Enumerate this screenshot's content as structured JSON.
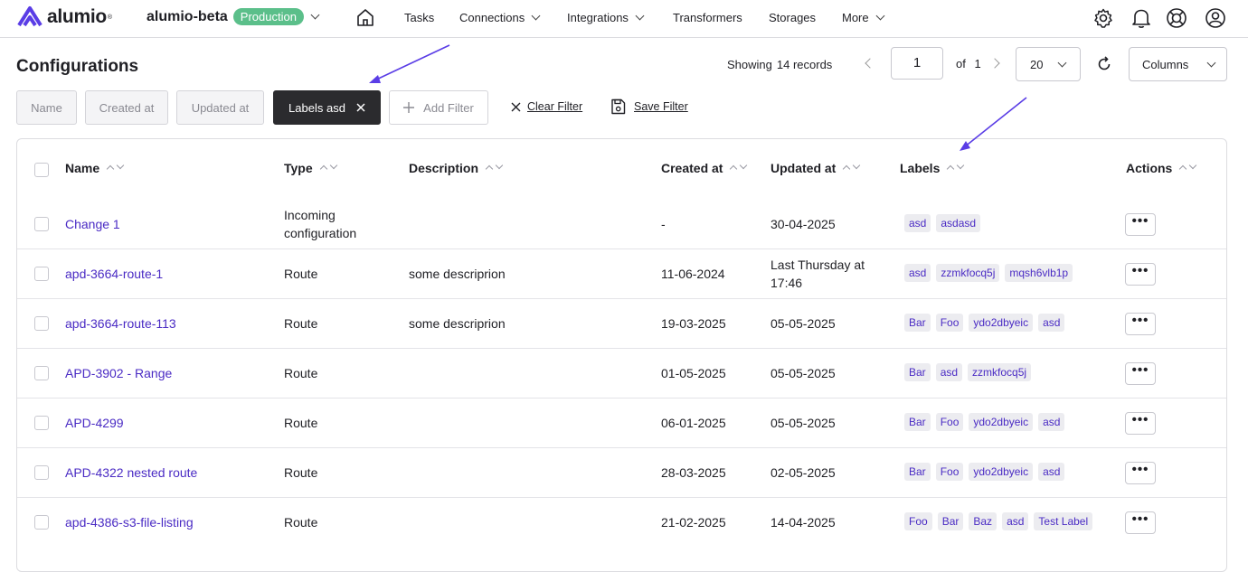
{
  "brand": {
    "name": "alumio",
    "reg": "®"
  },
  "environment": {
    "name": "alumio-beta",
    "badge": "Production"
  },
  "nav": {
    "items": [
      "Tasks",
      "Connections",
      "Integrations",
      "Transformers",
      "Storages",
      "More"
    ]
  },
  "page": {
    "title": "Configurations"
  },
  "pagination": {
    "showing_label": "Showing",
    "records": "14 records",
    "page": "1",
    "of_label": "of",
    "total_pages": "1",
    "page_size": "20",
    "columns_label": "Columns"
  },
  "filters": {
    "chips": [
      "Name",
      "Created at",
      "Updated at"
    ],
    "active": "Labels asd",
    "add": "Add Filter",
    "clear": "Clear Filter",
    "save": "Save Filter"
  },
  "table": {
    "headers": [
      "Name",
      "Type",
      "Description",
      "Created at",
      "Updated at",
      "Labels",
      "Actions"
    ],
    "rows": [
      {
        "name": "Change 1",
        "type": "Incoming configuration",
        "description": "",
        "created": "-",
        "updated": "30-04-2025",
        "labels": [
          "asd",
          "asdasd"
        ]
      },
      {
        "name": "apd-3664-route-1",
        "type": "Route",
        "description": "some descriprion",
        "created": "11-06-2024",
        "updated": "Last Thursday at 17:46",
        "labels": [
          "asd",
          "zzmkfocq5j",
          "mqsh6vlb1p"
        ]
      },
      {
        "name": "apd-3664-route-113",
        "type": "Route",
        "description": "some descriprion",
        "created": "19-03-2025",
        "updated": "05-05-2025",
        "labels": [
          "Bar",
          "Foo",
          "ydo2dbyeic",
          "asd"
        ]
      },
      {
        "name": "APD-3902 - Range",
        "type": "Route",
        "description": "",
        "created": "01-05-2025",
        "updated": "05-05-2025",
        "labels": [
          "Bar",
          "asd",
          "zzmkfocq5j"
        ]
      },
      {
        "name": "APD-4299",
        "type": "Route",
        "description": "",
        "created": "06-01-2025",
        "updated": "05-05-2025",
        "labels": [
          "Bar",
          "Foo",
          "ydo2dbyeic",
          "asd"
        ]
      },
      {
        "name": "APD-4322 nested route",
        "type": "Route",
        "description": "",
        "created": "28-03-2025",
        "updated": "02-05-2025",
        "labels": [
          "Bar",
          "Foo",
          "ydo2dbyeic",
          "asd"
        ]
      },
      {
        "name": "apd-4386-s3-file-listing",
        "type": "Route",
        "description": "",
        "created": "21-02-2025",
        "updated": "14-04-2025",
        "labels": [
          "Foo",
          "Bar",
          "Baz",
          "asd",
          "Test Label"
        ]
      }
    ],
    "action_label": "•••"
  },
  "colors": {
    "accent": "#4a2bc4",
    "badge": "#5bbf8a",
    "annotation_arrow": "#5a3de6"
  }
}
